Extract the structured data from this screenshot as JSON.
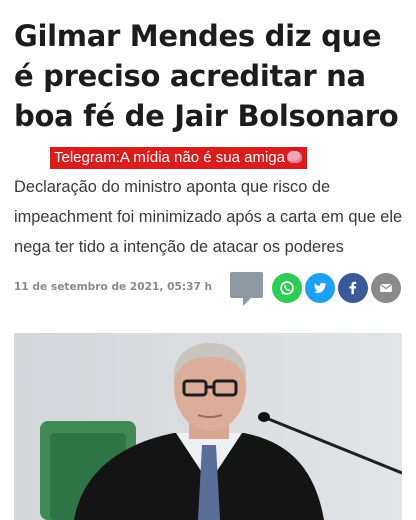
{
  "article": {
    "headline": "Gilmar Mendes diz que é preciso acreditar na boa fé de Jair Bolsonaro",
    "telegram_banner": "Telegram:A mídia não é sua amiga",
    "subtitle": "Declaração do ministro aponta que risco de impeachment foi minimizado após a carta em que ele nega ter tido a intenção de atacar os poderes",
    "dateline": "11 de setembro de 2021, 05:37 h"
  },
  "share_icons": [
    "comment-icon",
    "whatsapp-icon",
    "twitter-icon",
    "facebook-icon",
    "email-icon"
  ],
  "colors": {
    "banner_red": "#d91c1c",
    "whatsapp": "#2ecc55",
    "twitter": "#1da1f2",
    "facebook": "#3b5998",
    "email": "#8a8a8a",
    "comment": "#8c99a3"
  }
}
